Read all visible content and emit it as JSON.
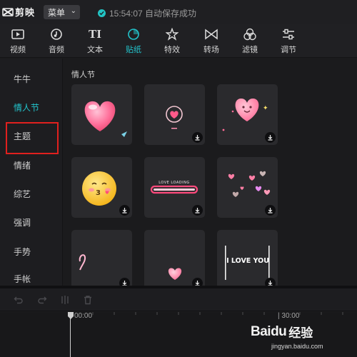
{
  "app": {
    "name": "剪映"
  },
  "titlebar": {
    "menu_label": "菜单",
    "status_text": "15:54:07 自动保存成功"
  },
  "toolbar": {
    "items": [
      {
        "label": "视频",
        "icon": "video-icon"
      },
      {
        "label": "音频",
        "icon": "audio-icon"
      },
      {
        "label": "文本",
        "icon": "text-icon"
      },
      {
        "label": "贴纸",
        "icon": "sticker-icon",
        "active": true
      },
      {
        "label": "特效",
        "icon": "effects-icon"
      },
      {
        "label": "转场",
        "icon": "transition-icon"
      },
      {
        "label": "滤镜",
        "icon": "filter-icon"
      },
      {
        "label": "调节",
        "icon": "adjust-icon"
      }
    ]
  },
  "sidebar": {
    "items": [
      {
        "label": "牛牛"
      },
      {
        "label": "情人节",
        "active": true
      },
      {
        "label": "主题",
        "highlighted": true
      },
      {
        "label": "情绪"
      },
      {
        "label": "综艺"
      },
      {
        "label": "强调"
      },
      {
        "label": "手势"
      },
      {
        "label": "手帐"
      }
    ]
  },
  "main": {
    "section_title": "情人节",
    "stickers": [
      {
        "name": "glossy-pink-heart"
      },
      {
        "name": "heart-ring-icon",
        "downloadable": true
      },
      {
        "name": "smiling-heart",
        "downloadable": true
      },
      {
        "name": "kissing-emoji",
        "downloadable": true
      },
      {
        "name": "love-loading",
        "caption": "LOVE LOADING",
        "downloadable": true
      },
      {
        "name": "floating-hearts",
        "downloadable": true
      },
      {
        "name": "neon-scribble",
        "downloadable": true
      },
      {
        "name": "small-heart",
        "downloadable": true
      },
      {
        "name": "i-love-you-text",
        "caption": "I LOVE YOU",
        "downloadable": true
      }
    ]
  },
  "timeline": {
    "start_label": "00:00",
    "end_label": "| 30:00"
  },
  "watermark": {
    "brand": "Baidu",
    "brand_cn": "经验",
    "url": "jingyan.baidu.com"
  },
  "colors": {
    "accent": "#22c4cc",
    "highlight_box": "#e0201e",
    "background": "#1b1b1d"
  }
}
